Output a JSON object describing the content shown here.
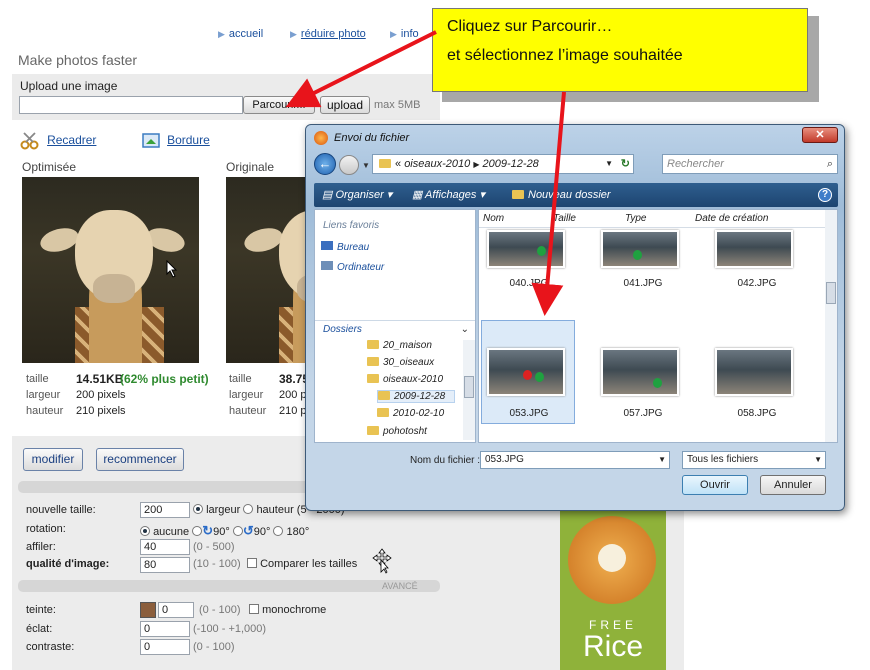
{
  "nav": {
    "items": [
      {
        "label": "accueil"
      },
      {
        "label": "réduire photo"
      },
      {
        "label": "info"
      }
    ]
  },
  "page": {
    "title": "Make photos faster",
    "upload_label": "Upload une image",
    "browse_label": "Parcourir...",
    "upload_button": "upload",
    "max_size": "max 5MB"
  },
  "tools": {
    "crop": "Recadrer",
    "border": "Bordure"
  },
  "optimized": {
    "heading": "Optimisée",
    "size_label": "taille",
    "size_value": "14.51KB",
    "saving": "(62% plus petit)",
    "width_label": "largeur",
    "width_value": "200 pixels",
    "height_label": "hauteur",
    "height_value": "210 pixels"
  },
  "original": {
    "heading": "Originale",
    "size_label": "taille",
    "size_value": "38.75",
    "width_label": "largeur",
    "width_value": "200 p",
    "height_label": "hauteur",
    "height_value": "210 p"
  },
  "actions": {
    "modify": "modifier",
    "restart": "recommencer"
  },
  "settings": {
    "new_size_label": "nouvelle taille:",
    "new_size_value": "200",
    "width_radio": "largeur",
    "height_radio": "hauteur (5 - 2000)",
    "rotation_label": "rotation:",
    "rot_none": "aucune",
    "rot_cw": "90°",
    "rot_ccw": "90°",
    "rot_180": "180°",
    "sharpen_label": "affiler:",
    "sharpen_value": "40",
    "sharpen_range": "(0 - 500)",
    "quality_label": "qualité d'image:",
    "quality_value": "80",
    "quality_range": "(10 - 100)",
    "compare_label": "Comparer les tailles",
    "advanced": "AVANCÉ",
    "tint_label": "teinte:",
    "tint_value": "0",
    "tint_range": "(0 - 100)",
    "tint_color": "#8b5e3c",
    "monochrome_label": "monochrome",
    "brightness_label": "éclat:",
    "brightness_value": "0",
    "brightness_range": "(-100 - +1,000)",
    "contrast_label": "contraste:",
    "contrast_value": "0",
    "contrast_range": "(0 - 100)"
  },
  "ad": {
    "line1": "FREE",
    "line2": "Rice"
  },
  "callout": {
    "line1": "Cliquez sur Parcourir…",
    "line2": "et sélectionnez l’image souhaitée"
  },
  "dialog": {
    "title": "Envoi du fichier",
    "breadcrumb_prefix": "«",
    "path1": "oiseaux-2010",
    "path2": "2009-12-28",
    "search_placeholder": "Rechercher",
    "toolbar": {
      "organize": "Organiser",
      "views": "Affichages",
      "new_folder": "Nouveau dossier"
    },
    "favorites_heading": "Liens favoris",
    "favorites": [
      {
        "label": "Bureau"
      },
      {
        "label": "Ordinateur"
      }
    ],
    "folders_heading": "Dossiers",
    "folders": [
      {
        "label": "20_maison"
      },
      {
        "label": "30_oiseaux"
      },
      {
        "label": "oiseaux-2010"
      },
      {
        "label": "2009-12-28"
      },
      {
        "label": "2010-02-10"
      },
      {
        "label": "pohotosht"
      }
    ],
    "columns": {
      "name": "Nom",
      "size": "Taille",
      "type": "Type",
      "date": "Date de création"
    },
    "files": [
      {
        "name": "040.JPG"
      },
      {
        "name": "041.JPG"
      },
      {
        "name": "042.JPG"
      },
      {
        "name": "053.JPG"
      },
      {
        "name": "057.JPG"
      },
      {
        "name": "058.JPG"
      }
    ],
    "filename_label": "Nom du fichier :",
    "filename_value": "053.JPG",
    "filetype_value": "Tous les fichiers",
    "open_button": "Ouvrir",
    "cancel_button": "Annuler"
  }
}
